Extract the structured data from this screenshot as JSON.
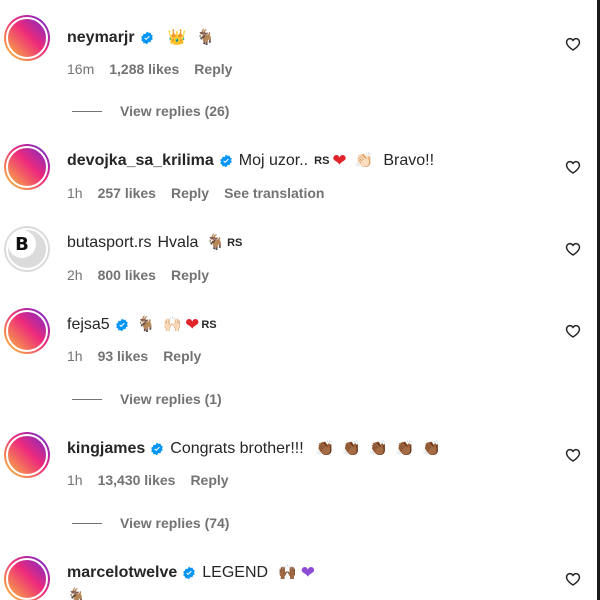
{
  "comments": [
    {
      "username": "neymarjr",
      "text": "",
      "emojis": [
        "👑",
        "🐐"
      ],
      "time": "16m",
      "likes": "1,288 likes",
      "reply": "Reply",
      "view_replies": "View replies (26)"
    },
    {
      "username": "devojka_sa_krilima",
      "text": "Moj uzor..",
      "rs_label": "RS",
      "clap_emoji": "👏🏻",
      "text2": "Bravo!!",
      "time": "1h",
      "likes": "257 likes",
      "reply": "Reply",
      "translation": "See translation"
    },
    {
      "username": "butasport.rs",
      "text": "Hvala",
      "emoji": "🐐",
      "rs_label": "RS",
      "time": "2h",
      "likes": "800 likes",
      "reply": "Reply",
      "avatar_letter": "B"
    },
    {
      "username": "fejsa5",
      "emojis": [
        "🐐",
        "🙌🏻"
      ],
      "rs_label": "RS",
      "time": "1h",
      "likes": "93 likes",
      "reply": "Reply",
      "view_replies": "View replies (1)"
    },
    {
      "username": "kingjames",
      "text": "Congrats brother!!!",
      "emojis": [
        "👏🏾",
        "👏🏾",
        "👏🏾",
        "👏🏾",
        "👏🏾"
      ],
      "time": "1h",
      "likes": "13,430 likes",
      "reply": "Reply",
      "view_replies": "View replies (74)"
    },
    {
      "username": "marcelotwelve",
      "text": "LEGEND",
      "emoji": "🙌🏾",
      "emoji_cont": "🐐"
    }
  ],
  "icons": {
    "verified": "verified-badge-icon",
    "like": "heart-outline-icon"
  },
  "colors": {
    "verified": "#0095f6",
    "heart": "#e0242c",
    "purple_heart": "#8d4bd6",
    "meta": "#737373"
  }
}
